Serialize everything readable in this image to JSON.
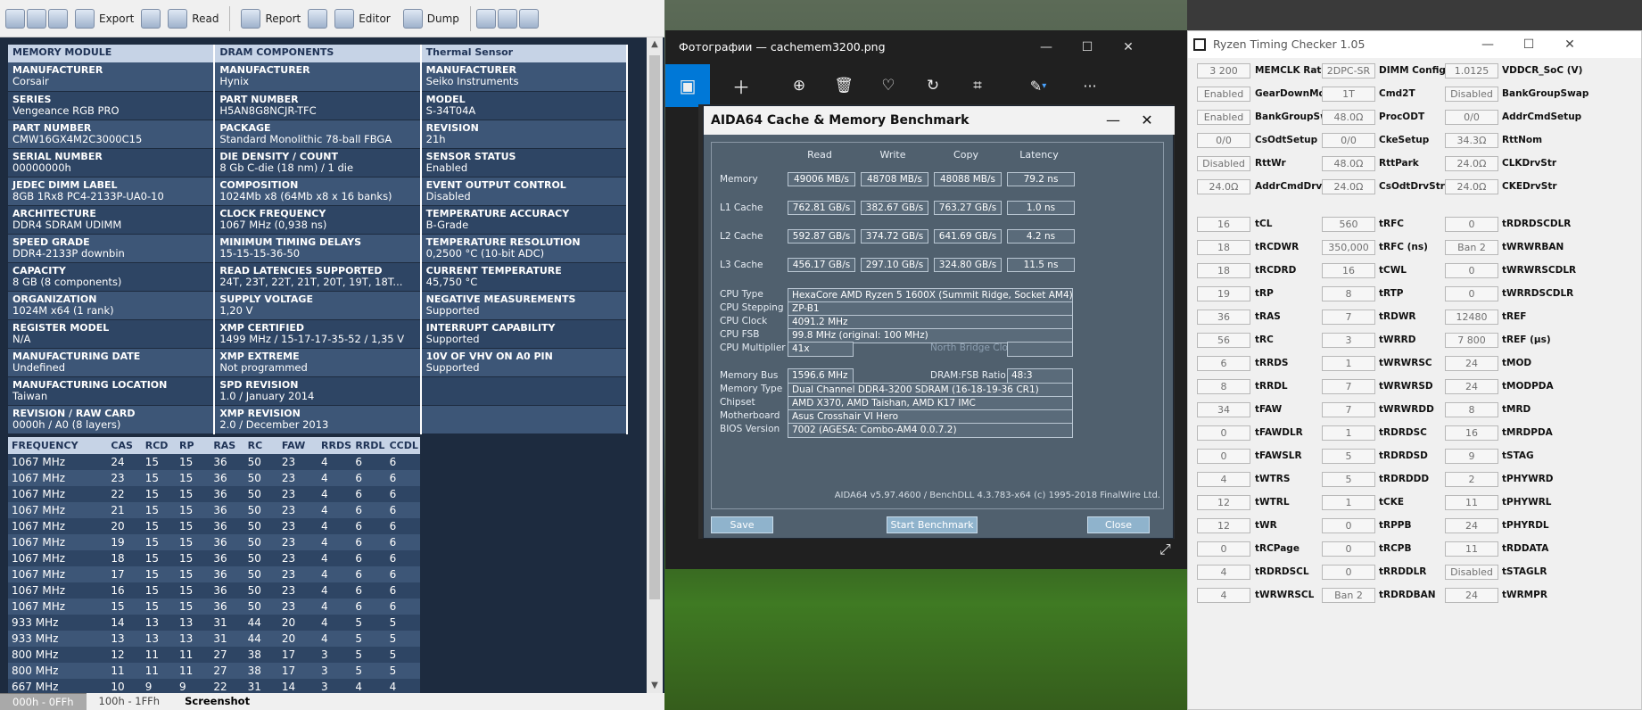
{
  "thaiphoon": {
    "toolbar": [
      "Export",
      "Read",
      "Report",
      "Editor",
      "Dump"
    ],
    "headers": [
      "MEMORY MODULE",
      "DRAM COMPONENTS",
      "Thermal Sensor"
    ],
    "rows": [
      [
        {
          "k": "MANUFACTURER",
          "v": "Corsair"
        },
        {
          "k": "MANUFACTURER",
          "v": "Hynix"
        },
        {
          "k": "MANUFACTURER",
          "v": "Seiko Instruments"
        }
      ],
      [
        {
          "k": "SERIES",
          "v": "Vengeance RGB PRO"
        },
        {
          "k": "PART NUMBER",
          "v": "H5AN8G8NCJR-TFC"
        },
        {
          "k": "MODEL",
          "v": "S-34T04A"
        }
      ],
      [
        {
          "k": "PART NUMBER",
          "v": "CMW16GX4M2C3000C15"
        },
        {
          "k": "PACKAGE",
          "v": "Standard Monolithic 78-ball FBGA"
        },
        {
          "k": "REVISION",
          "v": "21h"
        }
      ],
      [
        {
          "k": "SERIAL NUMBER",
          "v": "00000000h"
        },
        {
          "k": "DIE DENSITY / COUNT",
          "v": "8 Gb C-die (18 nm) / 1 die"
        },
        {
          "k": "SENSOR STATUS",
          "v": "Enabled"
        }
      ],
      [
        {
          "k": "JEDEC DIMM LABEL",
          "v": "8GB 1Rx8 PC4-2133P-UA0-10"
        },
        {
          "k": "COMPOSITION",
          "v": "1024Mb x8 (64Mb x8 x 16 banks)"
        },
        {
          "k": "EVENT OUTPUT CONTROL",
          "v": "Disabled"
        }
      ],
      [
        {
          "k": "ARCHITECTURE",
          "v": "DDR4 SDRAM UDIMM"
        },
        {
          "k": "CLOCK FREQUENCY",
          "v": "1067 MHz (0,938 ns)"
        },
        {
          "k": "TEMPERATURE ACCURACY",
          "v": "B-Grade"
        }
      ],
      [
        {
          "k": "SPEED GRADE",
          "v": "DDR4-2133P downbin"
        },
        {
          "k": "MINIMUM TIMING DELAYS",
          "v": "15-15-15-36-50"
        },
        {
          "k": "TEMPERATURE RESOLUTION",
          "v": "0,2500 °C (10-bit ADC)"
        }
      ],
      [
        {
          "k": "CAPACITY",
          "v": "8 GB (8 components)"
        },
        {
          "k": "READ LATENCIES SUPPORTED",
          "v": "24T, 23T, 22T, 21T, 20T, 19T, 18T..."
        },
        {
          "k": "CURRENT TEMPERATURE",
          "v": "45,750 °C"
        }
      ],
      [
        {
          "k": "ORGANIZATION",
          "v": "1024M x64 (1 rank)"
        },
        {
          "k": "SUPPLY VOLTAGE",
          "v": "1,20 V"
        },
        {
          "k": "NEGATIVE MEASUREMENTS",
          "v": "Supported"
        }
      ],
      [
        {
          "k": "REGISTER MODEL",
          "v": "N/A"
        },
        {
          "k": "XMP CERTIFIED",
          "v": "1499 MHz / 15-17-17-35-52 / 1,35 V"
        },
        {
          "k": "INTERRUPT CAPABILITY",
          "v": "Supported"
        }
      ],
      [
        {
          "k": "MANUFACTURING DATE",
          "v": "Undefined"
        },
        {
          "k": "XMP EXTREME",
          "v": "Not programmed"
        },
        {
          "k": "10V OF VHV ON A0 PIN",
          "v": "Supported"
        }
      ],
      [
        {
          "k": "MANUFACTURING LOCATION",
          "v": "Taiwan"
        },
        {
          "k": "SPD REVISION",
          "v": "1.0 / January 2014"
        },
        {
          "k": "",
          "v": ""
        }
      ],
      [
        {
          "k": "REVISION / RAW CARD",
          "v": "0000h / A0 (8 layers)"
        },
        {
          "k": "XMP REVISION",
          "v": "2.0 / December 2013"
        },
        {
          "k": "",
          "v": ""
        }
      ]
    ],
    "freq_headers": [
      "FREQUENCY",
      "CAS",
      "RCD",
      "RP",
      "RAS",
      "RC",
      "FAW",
      "RRDS",
      "RRDL",
      "CCDL"
    ],
    "freq_rows": [
      [
        "1067 MHz",
        "24",
        "15",
        "15",
        "36",
        "50",
        "23",
        "4",
        "6",
        "6"
      ],
      [
        "1067 MHz",
        "23",
        "15",
        "15",
        "36",
        "50",
        "23",
        "4",
        "6",
        "6"
      ],
      [
        "1067 MHz",
        "22",
        "15",
        "15",
        "36",
        "50",
        "23",
        "4",
        "6",
        "6"
      ],
      [
        "1067 MHz",
        "21",
        "15",
        "15",
        "36",
        "50",
        "23",
        "4",
        "6",
        "6"
      ],
      [
        "1067 MHz",
        "20",
        "15",
        "15",
        "36",
        "50",
        "23",
        "4",
        "6",
        "6"
      ],
      [
        "1067 MHz",
        "19",
        "15",
        "15",
        "36",
        "50",
        "23",
        "4",
        "6",
        "6"
      ],
      [
        "1067 MHz",
        "18",
        "15",
        "15",
        "36",
        "50",
        "23",
        "4",
        "6",
        "6"
      ],
      [
        "1067 MHz",
        "17",
        "15",
        "15",
        "36",
        "50",
        "23",
        "4",
        "6",
        "6"
      ],
      [
        "1067 MHz",
        "16",
        "15",
        "15",
        "36",
        "50",
        "23",
        "4",
        "6",
        "6"
      ],
      [
        "1067 MHz",
        "15",
        "15",
        "15",
        "36",
        "50",
        "23",
        "4",
        "6",
        "6"
      ],
      [
        "933 MHz",
        "14",
        "13",
        "13",
        "31",
        "44",
        "20",
        "4",
        "5",
        "5"
      ],
      [
        "933 MHz",
        "13",
        "13",
        "13",
        "31",
        "44",
        "20",
        "4",
        "5",
        "5"
      ],
      [
        "800 MHz",
        "12",
        "11",
        "11",
        "27",
        "38",
        "17",
        "3",
        "5",
        "5"
      ],
      [
        "800 MHz",
        "11",
        "11",
        "11",
        "27",
        "38",
        "17",
        "3",
        "5",
        "5"
      ],
      [
        "667 MHz",
        "10",
        "9",
        "9",
        "22",
        "31",
        "14",
        "3",
        "4",
        "4"
      ]
    ],
    "tabs": [
      "000h - 0FFh",
      "100h - 1FFh",
      "Screenshot"
    ]
  },
  "photos": {
    "title": "Фотографии — cachemem3200.png",
    "icons": [
      "photo-icon",
      "plus-icon",
      "zoom-icon",
      "delete-icon",
      "heart-icon",
      "rotate-icon",
      "crop-icon",
      "edit-icon",
      "more-icon"
    ]
  },
  "aida": {
    "title": "AIDA64 Cache & Memory Benchmark",
    "col_headers": [
      "Read",
      "Write",
      "Copy",
      "Latency"
    ],
    "bench_rows": [
      {
        "label": "Memory",
        "vals": [
          "49006 MB/s",
          "48708 MB/s",
          "48088 MB/s",
          "79.2 ns"
        ]
      },
      {
        "label": "L1 Cache",
        "vals": [
          "762.81 GB/s",
          "382.67 GB/s",
          "763.27 GB/s",
          "1.0 ns"
        ]
      },
      {
        "label": "L2 Cache",
        "vals": [
          "592.87 GB/s",
          "374.72 GB/s",
          "641.69 GB/s",
          "4.2 ns"
        ]
      },
      {
        "label": "L3 Cache",
        "vals": [
          "456.17 GB/s",
          "297.10 GB/s",
          "324.80 GB/s",
          "11.5 ns"
        ]
      }
    ],
    "cpu": [
      {
        "label": "CPU Type",
        "val": "HexaCore AMD Ryzen 5 1600X  (Summit Ridge, Socket AM4)"
      },
      {
        "label": "CPU Stepping",
        "val": "ZP-B1"
      },
      {
        "label": "CPU Clock",
        "val": "4091.2 MHz"
      },
      {
        "label": "CPU FSB",
        "val": "99.8 MHz  (original: 100 MHz)"
      },
      {
        "label": "CPU Multiplier",
        "val": "41x"
      }
    ],
    "nb_label": "North Bridge Clock",
    "mem_bus_label": "Memory Bus",
    "mem_bus": "1596.6 MHz",
    "ratio_label": "DRAM:FSB Ratio",
    "ratio": "48:3",
    "sys": [
      {
        "label": "Memory Type",
        "val": "Dual Channel DDR4-3200 SDRAM  (16-18-19-36 CR1)"
      },
      {
        "label": "Chipset",
        "val": "AMD X370, AMD Taishan, AMD K17 IMC"
      },
      {
        "label": "Motherboard",
        "val": "Asus Crosshair VI Hero"
      },
      {
        "label": "BIOS Version",
        "val": "7002  (AGESA: Combo-AM4 0.0.7.2)"
      }
    ],
    "version": "AIDA64 v5.97.4600 / BenchDLL 4.3.783-x64  (c) 1995-2018 FinalWire Ltd.",
    "save": "Save",
    "start": "Start Benchmark",
    "close": "Close"
  },
  "rtc": {
    "title": "Ryzen Timing Checker 1.05",
    "cols": [
      [
        [
          "3 200",
          "MEMCLK Ratio"
        ],
        [
          "Enabled",
          "GearDownMode"
        ],
        [
          "Enabled",
          "BankGroupSwapAlt"
        ],
        [
          "0/0",
          "CsOdtSetup"
        ],
        [
          "Disabled",
          "RttWr"
        ],
        [
          "24.0Ω",
          "AddrCmdDrvStr"
        ],
        null,
        [
          "16",
          "tCL"
        ],
        [
          "18",
          "tRCDWR"
        ],
        [
          "18",
          "tRCDRD"
        ],
        [
          "19",
          "tRP"
        ],
        [
          "36",
          "tRAS"
        ],
        [
          "56",
          "tRC"
        ],
        [
          "6",
          "tRRDS"
        ],
        [
          "8",
          "tRRDL"
        ],
        [
          "34",
          "tFAW"
        ],
        [
          "0",
          "tFAWDLR"
        ],
        [
          "0",
          "tFAWSLR"
        ],
        [
          "4",
          "tWTRS"
        ],
        [
          "12",
          "tWTRL"
        ],
        [
          "12",
          "tWR"
        ],
        [
          "0",
          "tRCPage"
        ],
        [
          "4",
          "tRDRDSCL"
        ],
        [
          "4",
          "tWRWRSCL"
        ]
      ],
      [
        [
          "2DPC-SR",
          "DIMM Config"
        ],
        [
          "1T",
          "Cmd2T"
        ],
        [
          "48.0Ω",
          "ProcODT"
        ],
        [
          "0/0",
          "CkeSetup"
        ],
        [
          "48.0Ω",
          "RttPark"
        ],
        [
          "24.0Ω",
          "CsOdtDrvStr"
        ],
        null,
        [
          "560",
          "tRFC"
        ],
        [
          "350,000",
          "tRFC (ns)"
        ],
        [
          "16",
          "tCWL"
        ],
        [
          "8",
          "tRTP"
        ],
        [
          "7",
          "tRDWR"
        ],
        [
          "3",
          "tWRRD"
        ],
        [
          "1",
          "tWRWRSC"
        ],
        [
          "7",
          "tWRWRSD"
        ],
        [
          "7",
          "tWRWRDD"
        ],
        [
          "1",
          "tRDRDSC"
        ],
        [
          "5",
          "tRDRDSD"
        ],
        [
          "5",
          "tRDRDDD"
        ],
        [
          "1",
          "tCKE"
        ],
        [
          "0",
          "tRPPB"
        ],
        [
          "0",
          "tRCPB"
        ],
        [
          "0",
          "tRRDDLR"
        ],
        [
          "Ban 2",
          "tRDRDBAN"
        ]
      ],
      [
        [
          "1.0125",
          "VDDCR_SoC (V)"
        ],
        [
          "Disabled",
          "BankGroupSwap"
        ],
        [
          "0/0",
          "AddrCmdSetup"
        ],
        [
          "34.3Ω",
          "RttNom"
        ],
        [
          "24.0Ω",
          "CLKDrvStr"
        ],
        [
          "24.0Ω",
          "CKEDrvStr"
        ],
        null,
        [
          "0",
          "tRDRDSCDLR"
        ],
        [
          "Ban 2",
          "tWRWRBAN"
        ],
        [
          "0",
          "tWRWRSCDLR"
        ],
        [
          "0",
          "tWRRDSCDLR"
        ],
        [
          "12480",
          "tREF"
        ],
        [
          "7 800",
          "tREF (µs)"
        ],
        [
          "24",
          "tMOD"
        ],
        [
          "24",
          "tMODPDA"
        ],
        [
          "8",
          "tMRD"
        ],
        [
          "16",
          "tMRDPDA"
        ],
        [
          "9",
          "tSTAG"
        ],
        [
          "2",
          "tPHYWRD"
        ],
        [
          "11",
          "tPHYWRL"
        ],
        [
          "24",
          "tPHYRDL"
        ],
        [
          "11",
          "tRDDATA"
        ],
        [
          "Disabled",
          "tSTAGLR"
        ],
        [
          "24",
          "tWRMPR"
        ]
      ]
    ]
  }
}
